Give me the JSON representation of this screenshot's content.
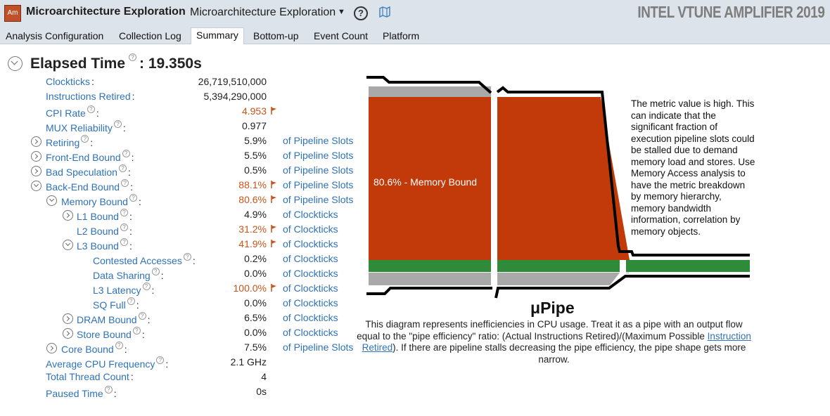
{
  "header": {
    "logo_text": "Am",
    "analysis_title": "Microarchitecture Exploration",
    "analysis_type": "Microarchitecture Exploration",
    "help_symbol": "?",
    "brand": "INTEL VTUNE AMPLIFIER 2019"
  },
  "tabs": [
    "Analysis Configuration",
    "Collection Log",
    "Summary",
    "Bottom-up",
    "Event Count",
    "Platform"
  ],
  "active_tab": "Summary",
  "elapsed": {
    "label": "Elapsed Time",
    "separator": ":",
    "value": "19.350s"
  },
  "metrics": [
    {
      "name": "Clockticks",
      "value": "26,719,510,000",
      "unit": "",
      "flag": false,
      "help": false
    },
    {
      "name": "Instructions Retired",
      "value": "5,394,290,000",
      "unit": "",
      "flag": false,
      "help": false
    },
    {
      "name": "CPI Rate",
      "value": "4.953",
      "unit": "",
      "flag": true,
      "help": true
    },
    {
      "name": "MUX Reliability",
      "value": "0.977",
      "unit": "",
      "flag": false,
      "help": true
    },
    {
      "name": "Retiring",
      "value": "5.9%",
      "unit": "of Pipeline Slots",
      "flag": false,
      "help": true
    },
    {
      "name": "Front-End Bound",
      "value": "5.5%",
      "unit": "of Pipeline Slots",
      "flag": false,
      "help": true
    },
    {
      "name": "Bad Speculation",
      "value": "0.5%",
      "unit": "of Pipeline Slots",
      "flag": false,
      "help": true
    },
    {
      "name": "Back-End Bound",
      "value": "88.1%",
      "unit": "of Pipeline Slots",
      "flag": true,
      "help": true
    },
    {
      "name": "Memory Bound",
      "value": "80.6%",
      "unit": "of Pipeline Slots",
      "flag": true,
      "help": true
    },
    {
      "name": "L1 Bound",
      "value": "4.9%",
      "unit": "of Clockticks",
      "flag": false,
      "help": true
    },
    {
      "name": "L2 Bound",
      "value": "31.2%",
      "unit": "of Clockticks",
      "flag": true,
      "help": true
    },
    {
      "name": "L3 Bound",
      "value": "41.9%",
      "unit": "of Clockticks",
      "flag": true,
      "help": true
    },
    {
      "name": "Contested Accesses",
      "value": "0.2%",
      "unit": "of Clockticks",
      "flag": false,
      "help": true
    },
    {
      "name": "Data Sharing",
      "value": "0.0%",
      "unit": "of Clockticks",
      "flag": false,
      "help": true
    },
    {
      "name": "L3 Latency",
      "value": "100.0%",
      "unit": "of Clockticks",
      "flag": true,
      "help": true
    },
    {
      "name": "SQ Full",
      "value": "0.0%",
      "unit": "of Clockticks",
      "flag": false,
      "help": true
    },
    {
      "name": "DRAM Bound",
      "value": "6.5%",
      "unit": "of Clockticks",
      "flag": false,
      "help": true
    },
    {
      "name": "Store Bound",
      "value": "0.0%",
      "unit": "of Clockticks",
      "flag": false,
      "help": true
    },
    {
      "name": "Core Bound",
      "value": "7.5%",
      "unit": "of Pipeline Slots",
      "flag": false,
      "help": true
    },
    {
      "name": "Average CPU Frequency",
      "value": "2.1 GHz",
      "unit": "",
      "flag": false,
      "help": true
    },
    {
      "name": "Total Thread Count",
      "value": "4",
      "unit": "",
      "flag": false,
      "help": false
    },
    {
      "name": "Paused Time",
      "value": "0s",
      "unit": "",
      "flag": false,
      "help": true
    }
  ],
  "pipe": {
    "bar_label": "80.6% - Memory Bound",
    "title": "μPipe",
    "description_before": "This diagram represents inefficiencies in CPU usage. Treat it as a pipe with an output flow equal to the \"pipe efficiency\" ratio: (Actual Instructions Retired)/(Maximum Possible ",
    "description_link": "Instruction Retired",
    "description_after": "). If there are pipeline stalls decreasing the pipe efficiency, the pipe shape gets more narrow.",
    "note": "The metric value is high. This can indicate that the significant fraction of execution pipeline slots could be stalled due to demand memory load and stores. Use Memory Access analysis to have the metric breakdown by memory hierarchy, memory bandwidth information, correlation by memory objects.",
    "colors": {
      "memory_bound": "#c23a0a",
      "retiring": "#2e8b3a",
      "other": "#a9a9a9",
      "outline": "#000000"
    }
  },
  "colors": {
    "link": "#2f72b8",
    "flagged": "#c8541b",
    "header_bg": "#dde3ea"
  }
}
